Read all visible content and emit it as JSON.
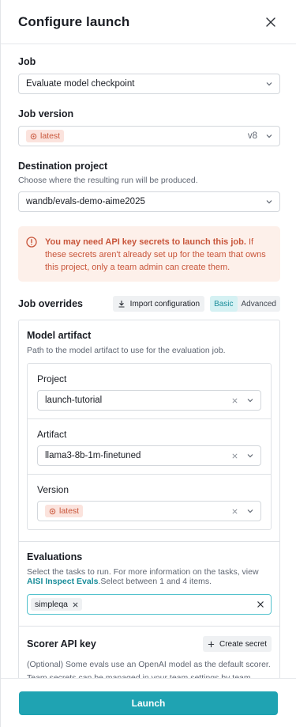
{
  "header": {
    "title": "Configure launch"
  },
  "job": {
    "label": "Job",
    "value": "Evaluate model checkpoint"
  },
  "job_version": {
    "label": "Job version",
    "tag": "latest",
    "version": "v8"
  },
  "destination": {
    "label": "Destination project",
    "help": "Choose where the resulting run will be produced.",
    "value": "wandb/evals-demo-aime2025"
  },
  "warning": {
    "bold": "You may need API key secrets to launch this job.",
    "rest": " If these secrets aren't already set up for the team that owns this project, only a team admin can create them."
  },
  "overrides": {
    "label": "Job overrides",
    "import_label": "Import configuration",
    "mode_basic": "Basic",
    "mode_advanced": "Advanced"
  },
  "model_artifact": {
    "label": "Model artifact",
    "help": "Path to the model artifact to use for the evaluation job.",
    "project_label": "Project",
    "project_value": "launch-tutorial",
    "artifact_label": "Artifact",
    "artifact_value": "llama3-8b-1m-finetuned",
    "version_label": "Version",
    "version_tag": "latest"
  },
  "evaluations": {
    "label": "Evaluations",
    "help_prefix": "Select the tasks to run. For more information on the tasks, view ",
    "help_link": "AISI Inspect Evals",
    "help_suffix": ".Select between 1 and 4 items.",
    "selected": [
      "simpleqa"
    ]
  },
  "scorer": {
    "label": "Scorer API key",
    "create_label": "Create secret",
    "help": "(Optional) Some evals use an OpenAI model as the default scorer. Team secrets can be managed in your team settings by team admins."
  },
  "footer": {
    "launch_label": "Launch"
  },
  "colors": {
    "accent": "#1fa3b2",
    "warning_text": "#c8553a",
    "warning_bg": "#fdf0ea"
  }
}
